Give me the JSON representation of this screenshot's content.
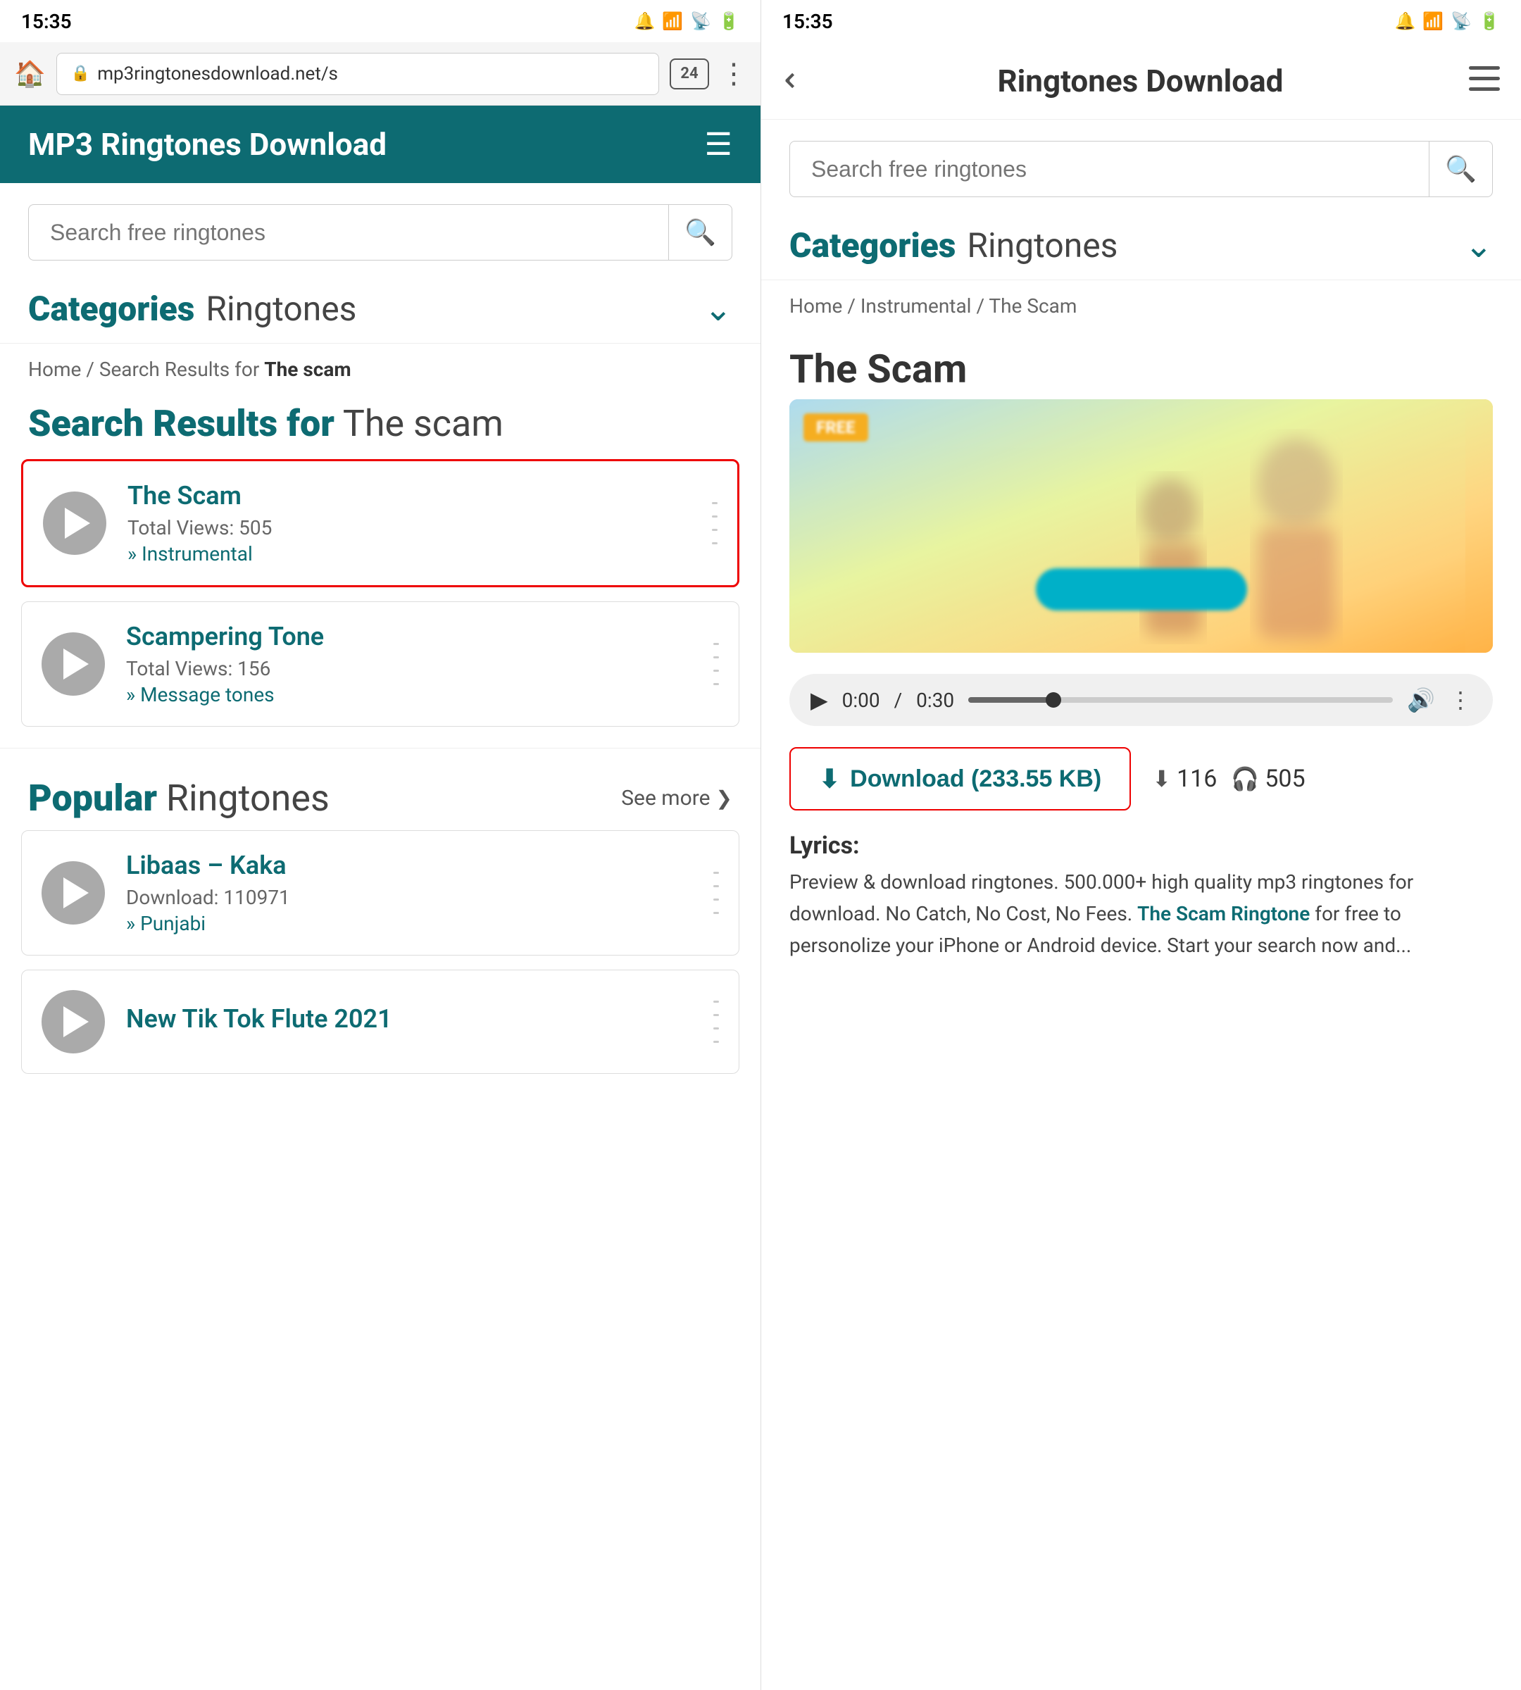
{
  "left": {
    "statusBar": {
      "time": "15:35",
      "icons": "🔔 ☀ 📶 🔋"
    },
    "browserBar": {
      "url": "mp3ringtonesdownload.net/s",
      "tabCount": "24"
    },
    "appHeader": {
      "title": "MP3 Ringtones Download",
      "menuIcon": "☰"
    },
    "search": {
      "placeholder": "Search free ringtones",
      "buttonIcon": "🔍"
    },
    "categories": {
      "boldLabel": "Categories",
      "lightLabel": "Ringtones",
      "chevron": "⌄"
    },
    "breadcrumb": {
      "home": "Home",
      "separator": " / ",
      "resultsLabel": "Search Results for",
      "query": "The scam"
    },
    "searchResults": {
      "heading": {
        "bold": "Search Results for",
        "light": "The scam"
      },
      "items": [
        {
          "title": "The Scam",
          "views": "Total Views: 505",
          "category": "Instrumental",
          "selected": true
        },
        {
          "title": "Scampering Tone",
          "views": "Total Views: 156",
          "category": "Message tones",
          "selected": false
        }
      ]
    },
    "popular": {
      "boldLabel": "Popular",
      "lightLabel": "Ringtones",
      "seeMore": "See more",
      "seeMoreArrow": "❯",
      "items": [
        {
          "title": "Libaas – Kaka",
          "downloads": "Download: 110971",
          "category": "Punjabi"
        },
        {
          "title": "New Tik Tok Flute 2021",
          "downloads": "",
          "category": ""
        }
      ]
    }
  },
  "right": {
    "statusBar": {
      "time": "15:35",
      "icons": "🔔 ☀ 📶 🔋"
    },
    "topNav": {
      "backArrow": "⌄",
      "title": "Ringtones Download",
      "menuIcon": "☰"
    },
    "search": {
      "placeholder": "Search free ringtones",
      "buttonIcon": "🔍"
    },
    "categories": {
      "boldLabel": "Categories",
      "lightLabel": "Ringtones",
      "chevron": "⌄"
    },
    "breadcrumb": {
      "home": "Home",
      "sep1": " / ",
      "instrumental": "Instrumental",
      "sep2": " / ",
      "current": "The Scam"
    },
    "detail": {
      "title": "The Scam",
      "audioPlayer": {
        "playIcon": "▶",
        "currentTime": "0:00",
        "separator": " / ",
        "duration": "0:30",
        "fillPercent": "20",
        "volumeIcon": "🔊",
        "moreIcon": "⋮"
      },
      "downloadBtn": {
        "icon": "⬇",
        "label": "Download (233.55 KB)"
      },
      "stats": {
        "downloadCount": "116",
        "downloadIcon": "⬇",
        "viewCount": "505",
        "viewIcon": "🎧"
      },
      "lyricsLabel": "Lyrics:",
      "lyricsText": "Preview & download ringtones. 500.000+ high quality mp3 ringtones for download. No Catch, No Cost, No Fees.",
      "lyricsLink": "The Scam Ringtone",
      "lyricsTextAfter": "for free to personolize your iPhone or Android device. Start your search now and..."
    }
  }
}
